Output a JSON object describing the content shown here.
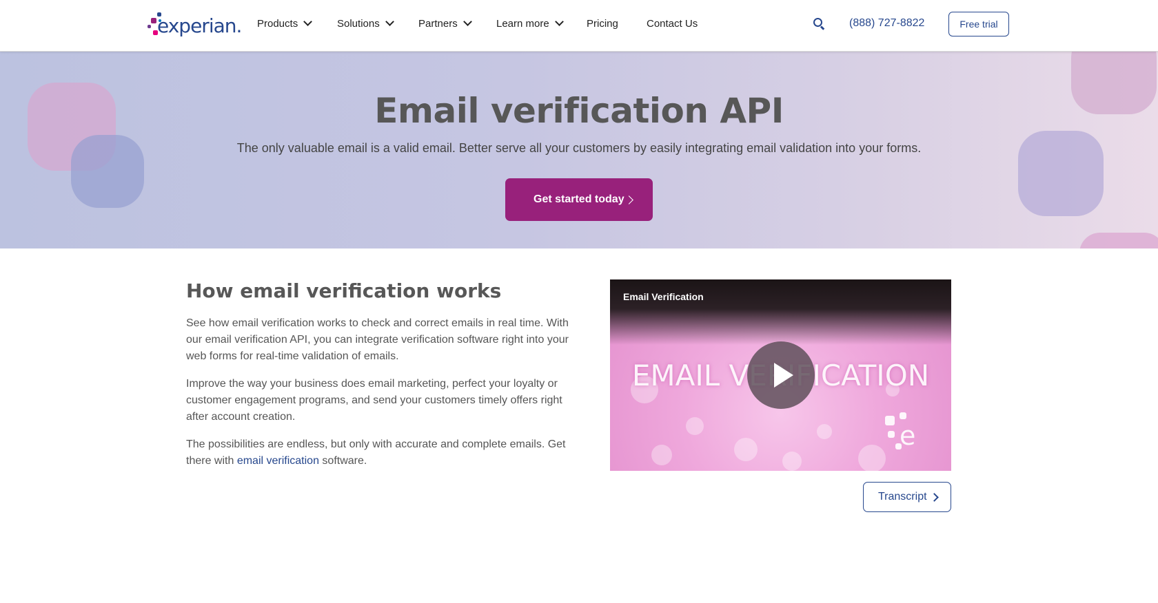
{
  "header": {
    "logo_text": "experian.",
    "nav": [
      {
        "label": "Products",
        "has_dropdown": true
      },
      {
        "label": "Solutions",
        "has_dropdown": true
      },
      {
        "label": "Partners",
        "has_dropdown": true
      },
      {
        "label": "Learn more",
        "has_dropdown": true
      },
      {
        "label": "Pricing",
        "has_dropdown": false
      },
      {
        "label": "Contact Us",
        "has_dropdown": false
      }
    ],
    "search_icon": "search-icon",
    "phone": "(888) 727-8822",
    "free_trial_label": "Free trial"
  },
  "hero": {
    "title": "Email verification API",
    "subtitle": "The only valuable email is a valid email. Better serve all your customers by easily integrating email validation into your forms.",
    "cta_label": "Get started today"
  },
  "main": {
    "heading": "How email verification works",
    "paragraphs": [
      "See how email verification works to check and correct emails in real time. With our email verification API, you can integrate verification software right into your web forms for real-time validation of emails.",
      "Improve the way your business does email marketing, perfect your loyalty or customer engagement programs, and send your customers timely offers right after account creation."
    ],
    "para3_before": "The possibilities are endless, but only with accurate and complete emails. Get there with ",
    "para3_link": "email verification",
    "para3_after": " software."
  },
  "video": {
    "title": "Email Verification",
    "overlay_text": "EMAIL VERIFICATION",
    "play_icon": "play-icon"
  },
  "transcript_label": "Transcript",
  "colors": {
    "brand_blue": "#26478d",
    "cta_purple": "#98217b",
    "heading_gray": "#575757"
  }
}
